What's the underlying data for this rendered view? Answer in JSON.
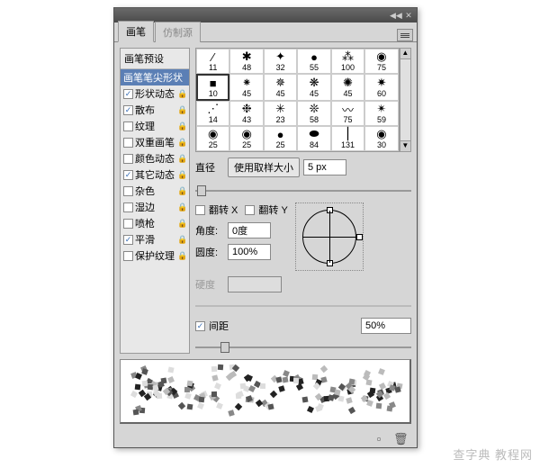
{
  "tabs": {
    "brush": "画笔",
    "clone": "仿制源"
  },
  "sidebar": {
    "header": "画笔预设",
    "items": [
      {
        "label": "画笔笔尖形状",
        "checked": null,
        "sel": true,
        "lock": false
      },
      {
        "label": "形状动态",
        "checked": true,
        "lock": true
      },
      {
        "label": "散布",
        "checked": true,
        "lock": true
      },
      {
        "label": "纹理",
        "checked": false,
        "lock": true
      },
      {
        "label": "双重画笔",
        "checked": false,
        "lock": true
      },
      {
        "label": "颜色动态",
        "checked": false,
        "lock": true
      },
      {
        "label": "其它动态",
        "checked": true,
        "lock": true
      },
      {
        "label": "杂色",
        "checked": false,
        "lock": true
      },
      {
        "label": "湿边",
        "checked": false,
        "lock": true
      },
      {
        "label": "喷枪",
        "checked": false,
        "lock": true
      },
      {
        "label": "平滑",
        "checked": true,
        "lock": true
      },
      {
        "label": "保护纹理",
        "checked": false,
        "lock": true
      }
    ]
  },
  "brushes": [
    {
      "n": "11"
    },
    {
      "n": "48"
    },
    {
      "n": "32"
    },
    {
      "n": "55"
    },
    {
      "n": "100"
    },
    {
      "n": "75"
    },
    {
      "n": "10",
      "sel": true
    },
    {
      "n": "45"
    },
    {
      "n": "45"
    },
    {
      "n": "45"
    },
    {
      "n": "45"
    },
    {
      "n": "60"
    },
    {
      "n": "14"
    },
    {
      "n": "43"
    },
    {
      "n": "23"
    },
    {
      "n": "58"
    },
    {
      "n": "75"
    },
    {
      "n": "59"
    },
    {
      "n": "25"
    },
    {
      "n": "25"
    },
    {
      "n": "25"
    },
    {
      "n": "84"
    },
    {
      "n": "131"
    },
    {
      "n": "30"
    }
  ],
  "diameter": {
    "label": "直径",
    "btn": "使用取样大小",
    "value": "5 px"
  },
  "flip": {
    "x": "翻转 X",
    "y": "翻转 Y",
    "xc": false,
    "yc": false
  },
  "angle": {
    "label": "角度:",
    "value": "0度"
  },
  "round": {
    "label": "圆度:",
    "value": "100%"
  },
  "hardness": {
    "label": "硬度"
  },
  "spacing": {
    "label": "间距",
    "checked": true,
    "value": "50%"
  },
  "watermark": "查字典  教程网"
}
